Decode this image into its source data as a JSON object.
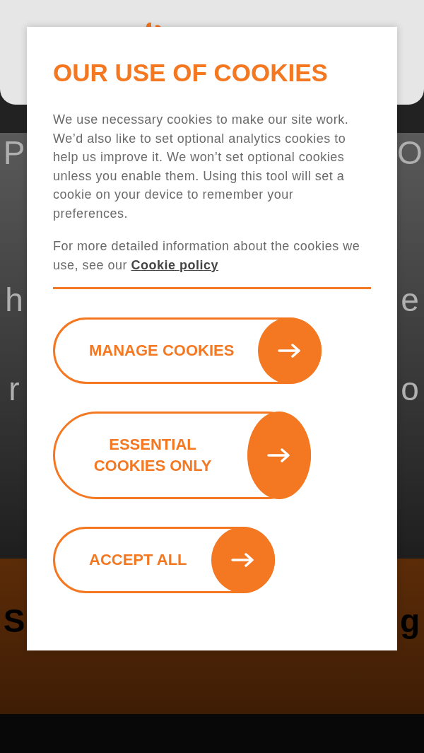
{
  "background": {
    "fragments": [
      {
        "left": "P",
        "right": "O",
        "kind": "light"
      },
      {
        "left": "h",
        "right": "e",
        "kind": "light"
      },
      {
        "left": "r",
        "right": "o",
        "kind": "light"
      },
      {
        "left": "S",
        "right": "g",
        "kind": "dark"
      }
    ]
  },
  "dialog": {
    "title": "OUR USE OF COOKIES",
    "paragraph": "We use necessary cookies to make our site work. We’d also like to set optional analytics cookies to help us improve it. We won’t set optional cookies unless you enable them. Using this tool will set a cookie on your device to remember your preferences.",
    "policy_text": "For more detailed information about the cookies we use, see our",
    "policy_link": "Cookie policy",
    "buttons": [
      {
        "label": "MANAGE COOKIES"
      },
      {
        "label": "ESSENTIAL COOKIES ONLY"
      },
      {
        "label": "ACCEPT ALL"
      }
    ]
  }
}
